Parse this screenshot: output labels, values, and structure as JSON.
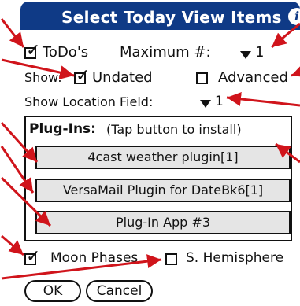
{
  "title": "Select Today View Items",
  "info_icon_glyph": "i",
  "todos": {
    "label": "ToDo's",
    "checked": true,
    "max_label": "Maximum #:",
    "max_value": "1"
  },
  "show": {
    "label": "Show:",
    "undated_label": "Undated",
    "undated_checked": true,
    "advanced_label": "Advanced",
    "advanced_checked": false
  },
  "location": {
    "label": "Show Location Field:",
    "value": "1"
  },
  "plugins": {
    "heading": "Plug-Ins:",
    "hint": "(Tap button to install)",
    "buttons": [
      "4cast weather plugin[1]",
      "VersaMail Plugin for DateBk6[1]",
      "Plug-In App #3"
    ]
  },
  "moon": {
    "label": "Moon Phases",
    "checked": true
  },
  "hemisphere": {
    "label": "S. Hemisphere",
    "checked": false
  },
  "ok_label": "OK",
  "cancel_label": "Cancel",
  "colors": {
    "titlebar": "#0f3a86",
    "annotation_arrow": "#d0141b"
  }
}
